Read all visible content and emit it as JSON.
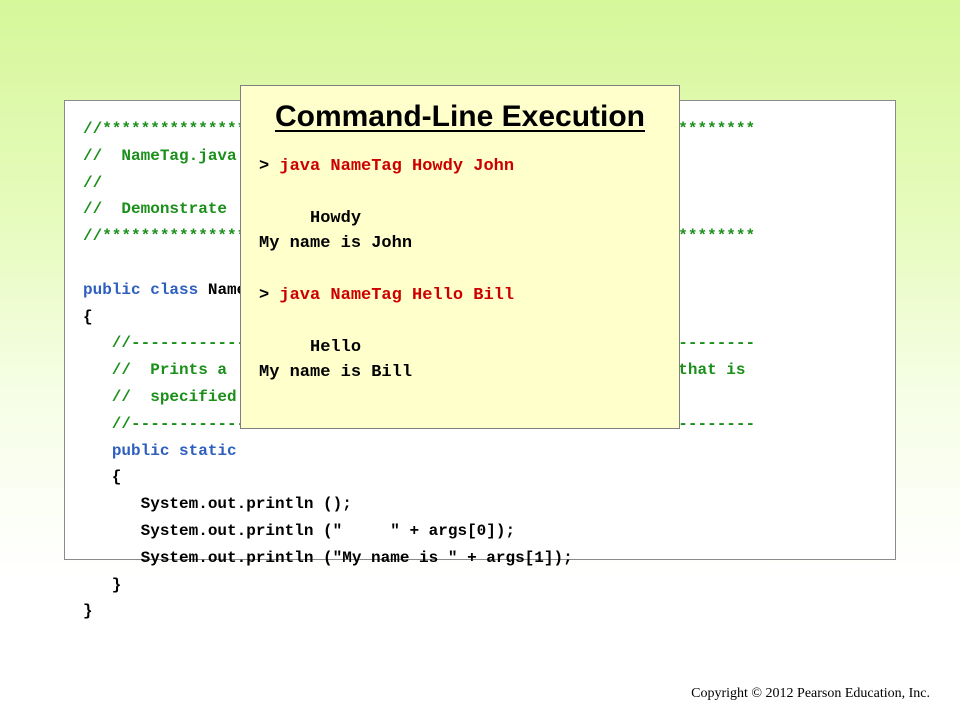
{
  "code": {
    "lines": [
      [
        {
          "t": "//********************************************************************",
          "c": "comment"
        }
      ],
      [
        {
          "t": "//  NameTag.java",
          "c": "comment"
        }
      ],
      [
        {
          "t": "//",
          "c": "comment"
        }
      ],
      [
        {
          "t": "//  Demonstrate",
          "c": "comment"
        }
      ],
      [
        {
          "t": "//********************************************************************",
          "c": "comment"
        }
      ],
      [
        {
          "t": "",
          "c": "plain"
        }
      ],
      [
        {
          "t": "public",
          "c": "keyword"
        },
        {
          "t": " ",
          "c": "plain"
        },
        {
          "t": "class",
          "c": "keyword"
        },
        {
          "t": " NameTag",
          "c": "plain"
        }
      ],
      [
        {
          "t": "{",
          "c": "plain"
        }
      ],
      [
        {
          "t": "   //-----------------------------------------------------------------",
          "c": "comment"
        }
      ],
      [
        {
          "t": "   //  Prints a                                        a name that is",
          "c": "comment"
        }
      ],
      [
        {
          "t": "   //  specified",
          "c": "comment"
        }
      ],
      [
        {
          "t": "   //-----------------------------------------------------------------",
          "c": "comment"
        }
      ],
      [
        {
          "t": "   ",
          "c": "plain"
        },
        {
          "t": "public",
          "c": "keyword"
        },
        {
          "t": " ",
          "c": "plain"
        },
        {
          "t": "static",
          "c": "keyword"
        }
      ],
      [
        {
          "t": "   {",
          "c": "plain"
        }
      ],
      [
        {
          "t": "      System.out.println ();",
          "c": "plain"
        }
      ],
      [
        {
          "t": "      System.out.println (\"     \" + args[0]);",
          "c": "plain"
        }
      ],
      [
        {
          "t": "      System.out.println (\"My name is \" + args[1]);",
          "c": "plain"
        }
      ],
      [
        {
          "t": "   }",
          "c": "plain"
        }
      ],
      [
        {
          "t": "}",
          "c": "plain"
        }
      ]
    ]
  },
  "popup": {
    "title": "Command-Line Execution",
    "lines": [
      {
        "prompt": "> ",
        "cmd": "java NameTag Howdy John",
        "text": ""
      },
      {
        "prompt": "",
        "cmd": "",
        "text": ""
      },
      {
        "prompt": "",
        "cmd": "",
        "text": "     Howdy"
      },
      {
        "prompt": "",
        "cmd": "",
        "text": "My name is John"
      },
      {
        "prompt": "",
        "cmd": "",
        "text": ""
      },
      {
        "prompt": "> ",
        "cmd": "java NameTag Hello Bill",
        "text": ""
      },
      {
        "prompt": "",
        "cmd": "",
        "text": ""
      },
      {
        "prompt": "",
        "cmd": "",
        "text": "     Hello"
      },
      {
        "prompt": "",
        "cmd": "",
        "text": "My name is Bill"
      }
    ]
  },
  "footer": {
    "copyright": "Copyright © 2012 Pearson Education, Inc."
  }
}
